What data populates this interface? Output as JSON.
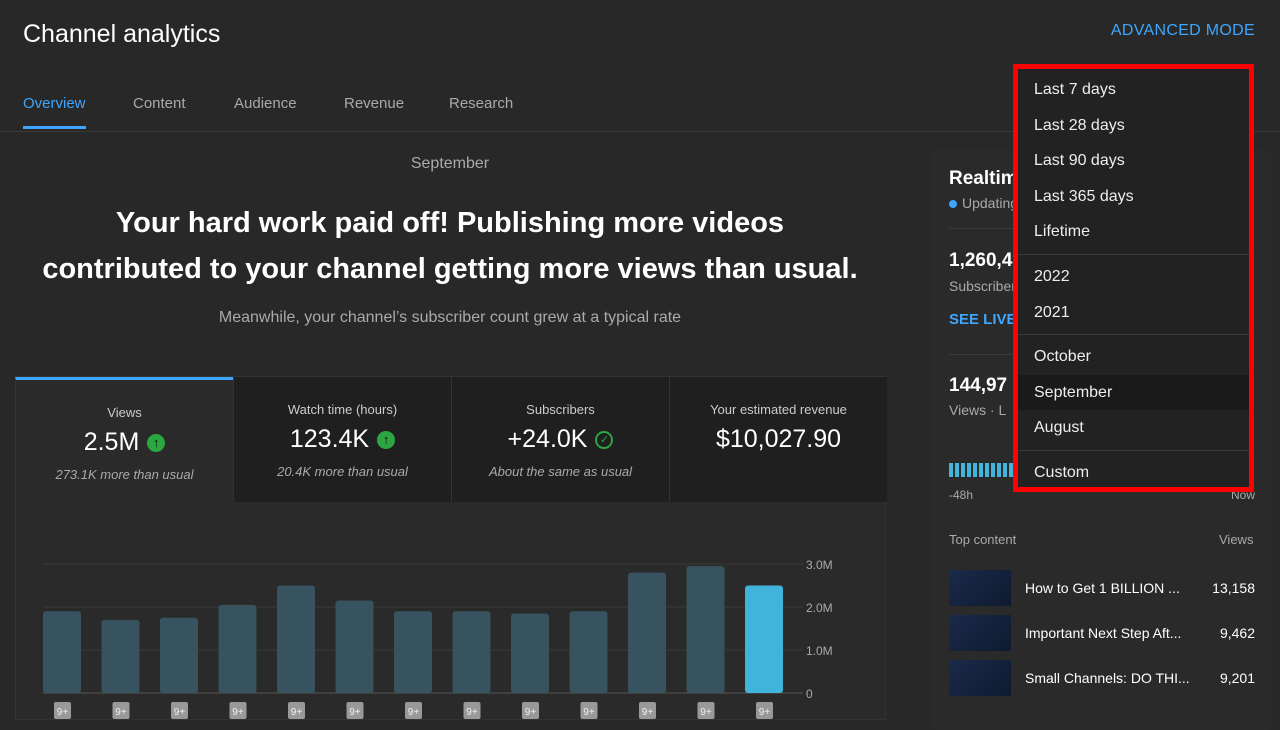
{
  "header": {
    "title": "Channel analytics",
    "advanced_mode": "ADVANCED MODE"
  },
  "tabs": [
    {
      "label": "Overview",
      "active": true
    },
    {
      "label": "Content"
    },
    {
      "label": "Audience"
    },
    {
      "label": "Revenue"
    },
    {
      "label": "Research"
    }
  ],
  "summary": {
    "period": "September",
    "headline": "Your hard work paid off! Publishing more videos contributed to your channel getting more views than usual.",
    "subline": "Meanwhile, your channel’s subscriber count grew at a typical rate"
  },
  "metrics": [
    {
      "label": "Views",
      "value": "2.5M",
      "icon": "arrow-up-icon",
      "note": "273.1K more than usual"
    },
    {
      "label": "Watch time (hours)",
      "value": "123.4K",
      "icon": "arrow-up-icon",
      "note": "20.4K more than usual"
    },
    {
      "label": "Subscribers",
      "value": "+24.0K",
      "icon": "check-circle-icon",
      "note": "About the same as usual"
    },
    {
      "label": "Your estimated revenue",
      "value": "$10,027.90",
      "icon": "",
      "note": ""
    }
  ],
  "chart_data": {
    "type": "bar",
    "values": [
      1.9,
      1.7,
      1.75,
      2.05,
      2.5,
      2.15,
      1.9,
      1.9,
      1.85,
      1.9,
      2.8,
      2.95,
      2.5
    ],
    "unit": "M views",
    "ylim": [
      0,
      3
    ],
    "yticks": [
      "0",
      "1.0M",
      "2.0M",
      "3.0M"
    ],
    "x_badge": "9+",
    "highlight_last": true,
    "colors": {
      "bar": "#37535f",
      "highlight": "#41b4dc"
    }
  },
  "realtime": {
    "title": "Realtime",
    "status": "Updating live",
    "subscribers": "1,260,4",
    "subscribers_label": "Subscribers",
    "see_live": "SEE LIVE",
    "views": "144,97",
    "views_label": "Views · L",
    "start_label": "-48h",
    "end_label": "Now",
    "top_content_label": "Top content",
    "views_col": "Views",
    "items": [
      {
        "title": "How to Get 1 BILLION ...",
        "views": "13,158"
      },
      {
        "title": "Important Next Step Aft...",
        "views": "9,462"
      },
      {
        "title": "Small Channels: DO THI...",
        "views": "9,201"
      }
    ]
  },
  "dropdown": {
    "groups": [
      [
        "Last 7 days",
        "Last 28 days",
        "Last 90 days",
        "Last 365 days",
        "Lifetime"
      ],
      [
        "2022",
        "2021"
      ],
      [
        "October",
        "September",
        "August"
      ],
      [
        "Custom"
      ]
    ],
    "selected": "September",
    "highlight_color": "#ff0000"
  }
}
